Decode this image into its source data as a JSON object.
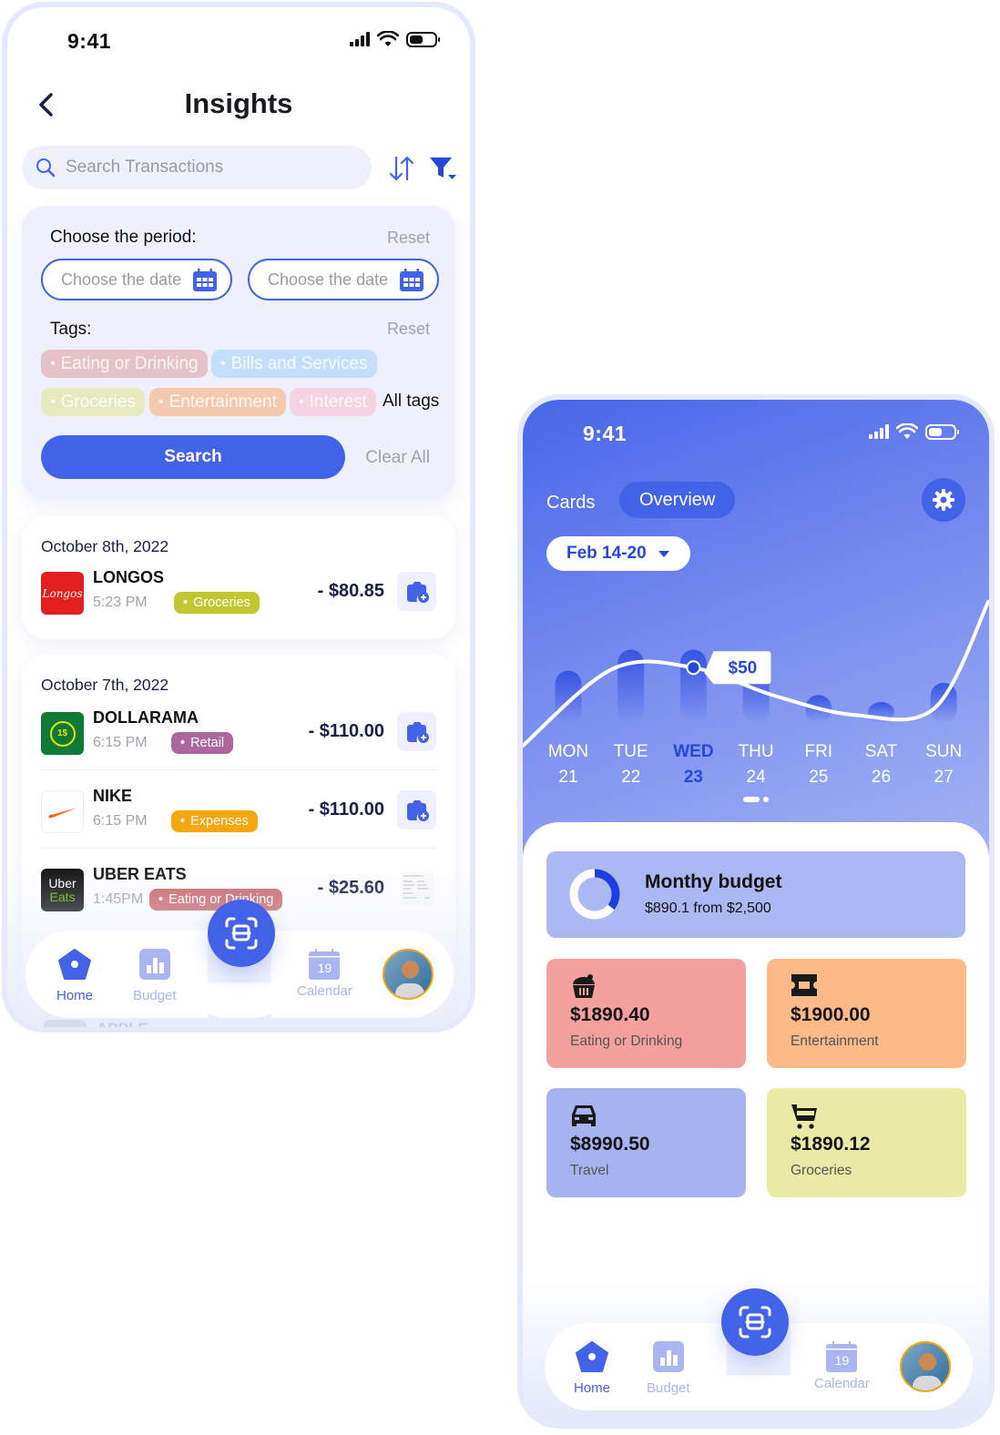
{
  "colors": {
    "accent": "#4262e8",
    "navy": "#1a1f4a",
    "muted": "#a2a2a8"
  },
  "insights": {
    "status_time": "9:41",
    "title": "Insights",
    "back_icon": "chevron-left-icon",
    "search": {
      "placeholder": "Search Transactions",
      "value": ""
    },
    "sort_icon": "sort-arrows-icon",
    "filter_icon": "filter-icon",
    "filter": {
      "period_label": "Choose the period:",
      "period_reset": "Reset",
      "date_from_placeholder": "Choose the date",
      "date_to_placeholder": "Choose the date",
      "tags_label": "Tags:",
      "tags_reset": "Reset",
      "tags": [
        {
          "label": "Eating or Drinking",
          "color": "#e5c1c8"
        },
        {
          "label": "Bills and Services",
          "color": "#c5defc"
        },
        {
          "label": "Groceries",
          "color": "#e6ebbf"
        },
        {
          "label": "Entertainment",
          "color": "#f4c9ad"
        },
        {
          "label": "Interest",
          "color": "#f6d3e0"
        }
      ],
      "all_tags": "All tags",
      "search_button": "Search",
      "clear_all": "Clear All"
    },
    "groups": [
      {
        "date": "October 8th, 2022",
        "transactions": [
          {
            "merchant": "LONGOS",
            "time": "5:23 PM",
            "tag": "Groceries",
            "tag_color": "#c2c62f",
            "amount": "- $80.85",
            "logo_text": "Longos",
            "logo_bg": "#e21f1f"
          }
        ]
      },
      {
        "date": "October 7th, 2022",
        "transactions": [
          {
            "merchant": "DOLLARAMA",
            "time": "6:15 PM",
            "tag": "Retail",
            "tag_color": "#a9679e",
            "amount": "- $110.00",
            "logo_text": "1$",
            "logo_bg": "#0e7a35"
          },
          {
            "merchant": "NIKE",
            "time": "6:15 PM",
            "tag": "Expenses",
            "tag_color": "#f5a70d",
            "amount": "- $110.00",
            "logo_text": "",
            "logo_bg": "#ffffff"
          },
          {
            "merchant": "UBER EATS",
            "time": "1:45PM",
            "tag": "Eating or Drinking",
            "tag_color": "#c96a6d",
            "amount": "- $25.60",
            "logo_text": "Uber Eats",
            "logo_bg": "#111111"
          }
        ]
      }
    ],
    "ghost_merchant": "APPLE",
    "nav": {
      "home": "Home",
      "budget": "Budget",
      "calendar": "Calendar",
      "calendar_day": "19"
    }
  },
  "overview": {
    "status_time": "9:41",
    "tabs": {
      "cards": "Cards",
      "overview": "Overview"
    },
    "period": "Feb 14-20",
    "tooltip": "$50",
    "chart_data": {
      "type": "bar",
      "title": "",
      "categories": [
        "MON",
        "TUE",
        "WED",
        "THU",
        "FRI",
        "SAT",
        "SUN"
      ],
      "dates": [
        "21",
        "22",
        "23",
        "24",
        "25",
        "26",
        "27"
      ],
      "selected_index": 2,
      "values": [
        30,
        42,
        42,
        32,
        16,
        12,
        23
      ],
      "trend": [
        0,
        45,
        50,
        40,
        18,
        22,
        80
      ],
      "xlabel": "",
      "ylabel": "",
      "ylim": [
        0,
        60
      ]
    },
    "page_dots": {
      "count": 2,
      "active": 0
    },
    "budget": {
      "title": "Monthy budget",
      "subtitle": "$890.1 from $2,500",
      "spent_fraction": 0.356
    },
    "categories": [
      {
        "amount": "$1890.40",
        "label": "Eating or Drinking",
        "icon": "cupcake-icon",
        "color": "#f4a09f"
      },
      {
        "amount": "$1900.00",
        "label": "Entertainment",
        "icon": "ticket-icon",
        "color": "#fdb988"
      },
      {
        "amount": "$8990.50",
        "label": "Travel",
        "icon": "car-icon",
        "color": "#a5b4ef"
      },
      {
        "amount": "$1890.12",
        "label": "Groceries",
        "icon": "cart-icon",
        "color": "#e9eaa6"
      }
    ],
    "nav": {
      "home": "Home",
      "budget": "Budget",
      "calendar": "Calendar",
      "calendar_day": "19"
    }
  }
}
